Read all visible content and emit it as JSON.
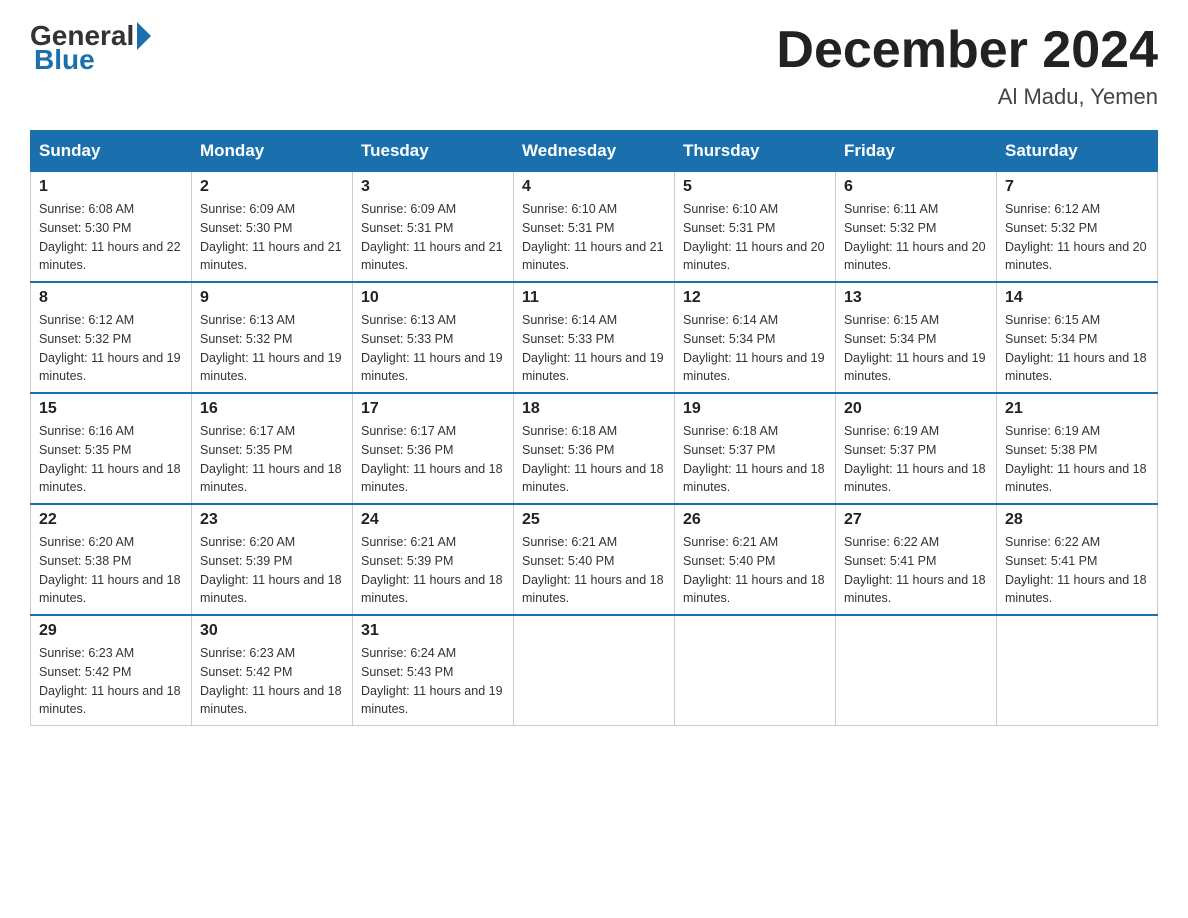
{
  "logo": {
    "general": "General",
    "blue": "Blue"
  },
  "title": "December 2024",
  "location": "Al Madu, Yemen",
  "days_of_week": [
    "Sunday",
    "Monday",
    "Tuesday",
    "Wednesday",
    "Thursday",
    "Friday",
    "Saturday"
  ],
  "weeks": [
    [
      {
        "day": "1",
        "sunrise": "6:08 AM",
        "sunset": "5:30 PM",
        "daylight": "11 hours and 22 minutes."
      },
      {
        "day": "2",
        "sunrise": "6:09 AM",
        "sunset": "5:30 PM",
        "daylight": "11 hours and 21 minutes."
      },
      {
        "day": "3",
        "sunrise": "6:09 AM",
        "sunset": "5:31 PM",
        "daylight": "11 hours and 21 minutes."
      },
      {
        "day": "4",
        "sunrise": "6:10 AM",
        "sunset": "5:31 PM",
        "daylight": "11 hours and 21 minutes."
      },
      {
        "day": "5",
        "sunrise": "6:10 AM",
        "sunset": "5:31 PM",
        "daylight": "11 hours and 20 minutes."
      },
      {
        "day": "6",
        "sunrise": "6:11 AM",
        "sunset": "5:32 PM",
        "daylight": "11 hours and 20 minutes."
      },
      {
        "day": "7",
        "sunrise": "6:12 AM",
        "sunset": "5:32 PM",
        "daylight": "11 hours and 20 minutes."
      }
    ],
    [
      {
        "day": "8",
        "sunrise": "6:12 AM",
        "sunset": "5:32 PM",
        "daylight": "11 hours and 19 minutes."
      },
      {
        "day": "9",
        "sunrise": "6:13 AM",
        "sunset": "5:32 PM",
        "daylight": "11 hours and 19 minutes."
      },
      {
        "day": "10",
        "sunrise": "6:13 AM",
        "sunset": "5:33 PM",
        "daylight": "11 hours and 19 minutes."
      },
      {
        "day": "11",
        "sunrise": "6:14 AM",
        "sunset": "5:33 PM",
        "daylight": "11 hours and 19 minutes."
      },
      {
        "day": "12",
        "sunrise": "6:14 AM",
        "sunset": "5:34 PM",
        "daylight": "11 hours and 19 minutes."
      },
      {
        "day": "13",
        "sunrise": "6:15 AM",
        "sunset": "5:34 PM",
        "daylight": "11 hours and 19 minutes."
      },
      {
        "day": "14",
        "sunrise": "6:15 AM",
        "sunset": "5:34 PM",
        "daylight": "11 hours and 18 minutes."
      }
    ],
    [
      {
        "day": "15",
        "sunrise": "6:16 AM",
        "sunset": "5:35 PM",
        "daylight": "11 hours and 18 minutes."
      },
      {
        "day": "16",
        "sunrise": "6:17 AM",
        "sunset": "5:35 PM",
        "daylight": "11 hours and 18 minutes."
      },
      {
        "day": "17",
        "sunrise": "6:17 AM",
        "sunset": "5:36 PM",
        "daylight": "11 hours and 18 minutes."
      },
      {
        "day": "18",
        "sunrise": "6:18 AM",
        "sunset": "5:36 PM",
        "daylight": "11 hours and 18 minutes."
      },
      {
        "day": "19",
        "sunrise": "6:18 AM",
        "sunset": "5:37 PM",
        "daylight": "11 hours and 18 minutes."
      },
      {
        "day": "20",
        "sunrise": "6:19 AM",
        "sunset": "5:37 PM",
        "daylight": "11 hours and 18 minutes."
      },
      {
        "day": "21",
        "sunrise": "6:19 AM",
        "sunset": "5:38 PM",
        "daylight": "11 hours and 18 minutes."
      }
    ],
    [
      {
        "day": "22",
        "sunrise": "6:20 AM",
        "sunset": "5:38 PM",
        "daylight": "11 hours and 18 minutes."
      },
      {
        "day": "23",
        "sunrise": "6:20 AM",
        "sunset": "5:39 PM",
        "daylight": "11 hours and 18 minutes."
      },
      {
        "day": "24",
        "sunrise": "6:21 AM",
        "sunset": "5:39 PM",
        "daylight": "11 hours and 18 minutes."
      },
      {
        "day": "25",
        "sunrise": "6:21 AM",
        "sunset": "5:40 PM",
        "daylight": "11 hours and 18 minutes."
      },
      {
        "day": "26",
        "sunrise": "6:21 AM",
        "sunset": "5:40 PM",
        "daylight": "11 hours and 18 minutes."
      },
      {
        "day": "27",
        "sunrise": "6:22 AM",
        "sunset": "5:41 PM",
        "daylight": "11 hours and 18 minutes."
      },
      {
        "day": "28",
        "sunrise": "6:22 AM",
        "sunset": "5:41 PM",
        "daylight": "11 hours and 18 minutes."
      }
    ],
    [
      {
        "day": "29",
        "sunrise": "6:23 AM",
        "sunset": "5:42 PM",
        "daylight": "11 hours and 18 minutes."
      },
      {
        "day": "30",
        "sunrise": "6:23 AM",
        "sunset": "5:42 PM",
        "daylight": "11 hours and 18 minutes."
      },
      {
        "day": "31",
        "sunrise": "6:24 AM",
        "sunset": "5:43 PM",
        "daylight": "11 hours and 19 minutes."
      },
      null,
      null,
      null,
      null
    ]
  ]
}
